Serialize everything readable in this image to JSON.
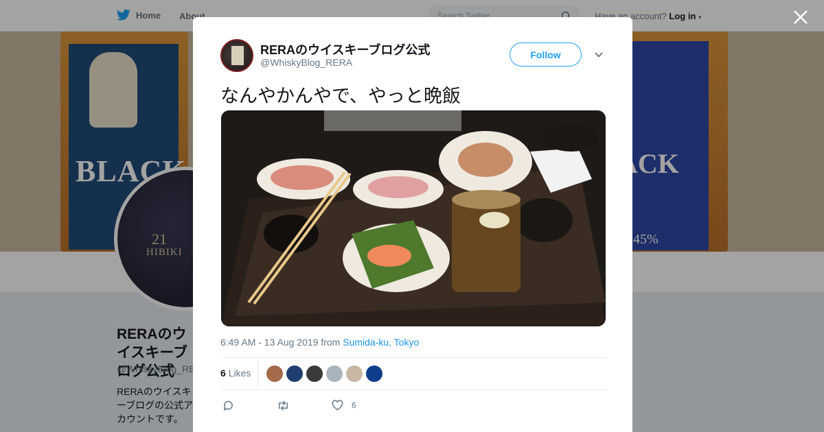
{
  "nav": {
    "home_label": "Home",
    "about_label": "About",
    "search_placeholder": "Search Twitter",
    "have_account": "Have an account?",
    "login_label": "Log in"
  },
  "banner": {
    "left_label": "BLACK",
    "right_label": "ACK",
    "right_pct": "45%"
  },
  "avatar": {
    "years": "21",
    "brand": "HIBIKI"
  },
  "profile": {
    "name": "RERAのウイスキーブログ公式",
    "handle": "@WhiskyBlog_RERA",
    "bio": "RERAのウイスキーブログの公式アカウントです。様々なウイスキーのテイスティング、評価"
  },
  "tweet": {
    "author_name": "RERAのウイスキーブログ公式",
    "author_handle": "@WhiskyBlog_RERA",
    "follow_label": "Follow",
    "text": "なんやかんやで、やっと晩飯",
    "time": "6:49 AM - 13 Aug 2019",
    "from_word": "from",
    "location": "Sumida-ku, Tokyo",
    "likes_count": "6",
    "likes_label": "Likes",
    "like_action_count": "6"
  },
  "likers": [
    {
      "name": "liker-1",
      "color": "#a36b4a"
    },
    {
      "name": "liker-2",
      "color": "#1f3f6e"
    },
    {
      "name": "liker-3",
      "color": "#3a3a3a"
    },
    {
      "name": "liker-4",
      "color": "#aab4bd"
    },
    {
      "name": "liker-5",
      "color": "#c9b7a5"
    },
    {
      "name": "liker-6",
      "color": "#0e3d8c"
    }
  ],
  "colors": {
    "accent": "#1da1f2",
    "link": "#1b95e0",
    "muted": "#657786"
  }
}
